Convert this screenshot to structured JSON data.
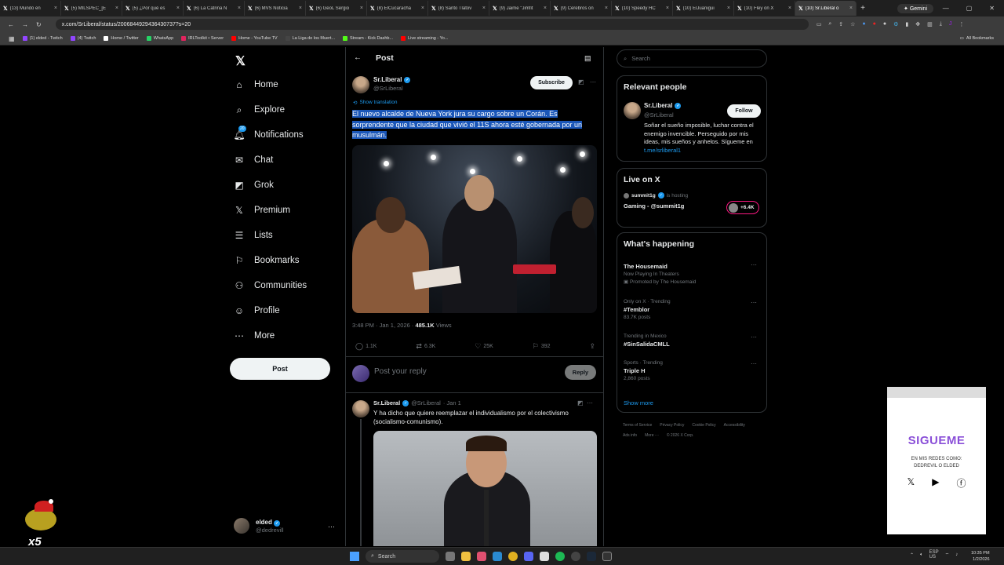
{
  "browser": {
    "tabs": [
      {
        "label": "(13) Mundo en"
      },
      {
        "label": "(5) MILSPEC_[E"
      },
      {
        "label": "(5) ¿Por qué es"
      },
      {
        "label": "(6) La Catrina N"
      },
      {
        "label": "(6) MVS Noticia"
      },
      {
        "label": "(6) GeoL Sergio"
      },
      {
        "label": "(8) ElCucaracha"
      },
      {
        "label": "(8) Santo Tlatov"
      },
      {
        "label": "(9) Jaime \"Jimfit"
      },
      {
        "label": "(9) Cerebros on"
      },
      {
        "label": "(10) Speedy HC"
      },
      {
        "label": "(10) ElJuanigui"
      },
      {
        "label": "(10) Fley on X"
      },
      {
        "label": "(10) Sr.Liberal o"
      }
    ],
    "gemini_label": "Gemini",
    "url": "x.com/SrLiberal/status/2006844929436430737?s=20",
    "bookmarks": [
      {
        "label": "(1) elded - Twitch",
        "color": "#9146ff"
      },
      {
        "label": "(4) Twitch",
        "color": "#9146ff"
      },
      {
        "label": "Home / Twitter",
        "color": "#ffffff"
      },
      {
        "label": "WhatsApp",
        "color": "#25d366"
      },
      {
        "label": "IRLToolkit • Server",
        "color": "#e0245e"
      },
      {
        "label": "Home - YouTube TV",
        "color": "#ff0000"
      },
      {
        "label": "La Liga de los Muert...",
        "color": "#444444"
      },
      {
        "label": "Stream - Kick Dashb...",
        "color": "#53fc18"
      },
      {
        "label": "Live streaming - Yo...",
        "color": "#ff0000"
      }
    ],
    "all_bookmarks": "All Bookmarks"
  },
  "sidebar": {
    "items": [
      {
        "label": "Home",
        "icon": "home-icon",
        "glyph": "⌂"
      },
      {
        "label": "Explore",
        "icon": "search-icon",
        "glyph": "⌕"
      },
      {
        "label": "Notifications",
        "icon": "bell-icon",
        "glyph": "🔔︎",
        "badge": "20"
      },
      {
        "label": "Chat",
        "icon": "mail-icon",
        "glyph": "✉"
      },
      {
        "label": "Grok",
        "icon": "grok-icon",
        "glyph": "◩"
      },
      {
        "label": "Premium",
        "icon": "x-logo-icon",
        "glyph": "𝕏"
      },
      {
        "label": "Lists",
        "icon": "lists-icon",
        "glyph": "☰"
      },
      {
        "label": "Bookmarks",
        "icon": "bookmark-icon",
        "glyph": "⚐"
      },
      {
        "label": "Communities",
        "icon": "communities-icon",
        "glyph": "⚇"
      },
      {
        "label": "Profile",
        "icon": "person-icon",
        "glyph": "☺"
      },
      {
        "label": "More",
        "icon": "more-circle-icon",
        "glyph": "⋯"
      }
    ],
    "post_button": "Post",
    "account": {
      "name": "elded",
      "handle": "@dedrevill"
    }
  },
  "main": {
    "header_title": "Post",
    "post": {
      "author_name": "Sr.Liberal",
      "author_handle": "@SrLiberal",
      "subscribe_label": "Subscribe",
      "show_translation": "Show translation",
      "text": "El nuevo alcalde de Nueva York jura su cargo sobre un Corán. Es sorprendente que la ciudad que vivió el 11S ahora esté gobernada por un musulmán.",
      "time": "3:48 PM · Jan 1, 2026 · ",
      "views": "485.1K",
      "views_label": " Views",
      "replies": "1.1K",
      "reposts": "6.3K",
      "likes": "25K",
      "bookmarks": "392"
    },
    "reply_box": {
      "placeholder": "Post your reply",
      "button": "Reply"
    },
    "reply": {
      "author_name": "Sr.Liberal",
      "author_handle": "@SrLiberal",
      "date": "· Jan 1",
      "text": "Y ha dicho que quiere reemplazar el individualismo por el colectivismo (socialismo-comunismo)."
    }
  },
  "right": {
    "search_placeholder": "Search",
    "relevant": {
      "title": "Relevant people",
      "name": "Sr.Liberal",
      "handle": "@SrLiberal",
      "follow": "Follow",
      "bio": "Soñar el sueño imposible, luchar contra el enemigo invencible. Perseguido por mis ideas, mis sueños y anhelos. Sígueme en ",
      "bio_link": "t.me/srliberal1"
    },
    "live": {
      "title": "Live on X",
      "host": "summit1g",
      "hosting": "is hosting",
      "stream_title": "Gaming - @summit1g",
      "count": "+6.4K"
    },
    "happening": {
      "title": "What's happening",
      "trends": [
        {
          "context": "",
          "name": "The Housemaid",
          "sub": "Now Playing In Theaters",
          "extra": "Promoted by The Housemaid"
        },
        {
          "context": "Only on X · Trending",
          "name": "#Temblor",
          "sub": "83.7K posts",
          "extra": ""
        },
        {
          "context": "Trending in Mexico",
          "name": "#SinSalidaCMLL",
          "sub": "",
          "extra": ""
        },
        {
          "context": "Sports · Trending",
          "name": "Triple H",
          "sub": "2,860 posts",
          "extra": ""
        }
      ],
      "show_more": "Show more"
    },
    "footer": [
      "Terms of Service",
      "Privacy Policy",
      "Cookie Policy",
      "Accessibility",
      "Ads info",
      "More ···",
      "© 2026 X Corp."
    ]
  },
  "overlay": {
    "title": "SIGUEME",
    "line1": "EN MIS REDES COMO:",
    "line2": "DEDREVIL O ELDED"
  },
  "taskbar": {
    "search": "Search",
    "lang1": "ESP",
    "lang2": "US",
    "time": "10:35 PM",
    "date": "1/2/2026"
  },
  "deco_badge": "x5"
}
